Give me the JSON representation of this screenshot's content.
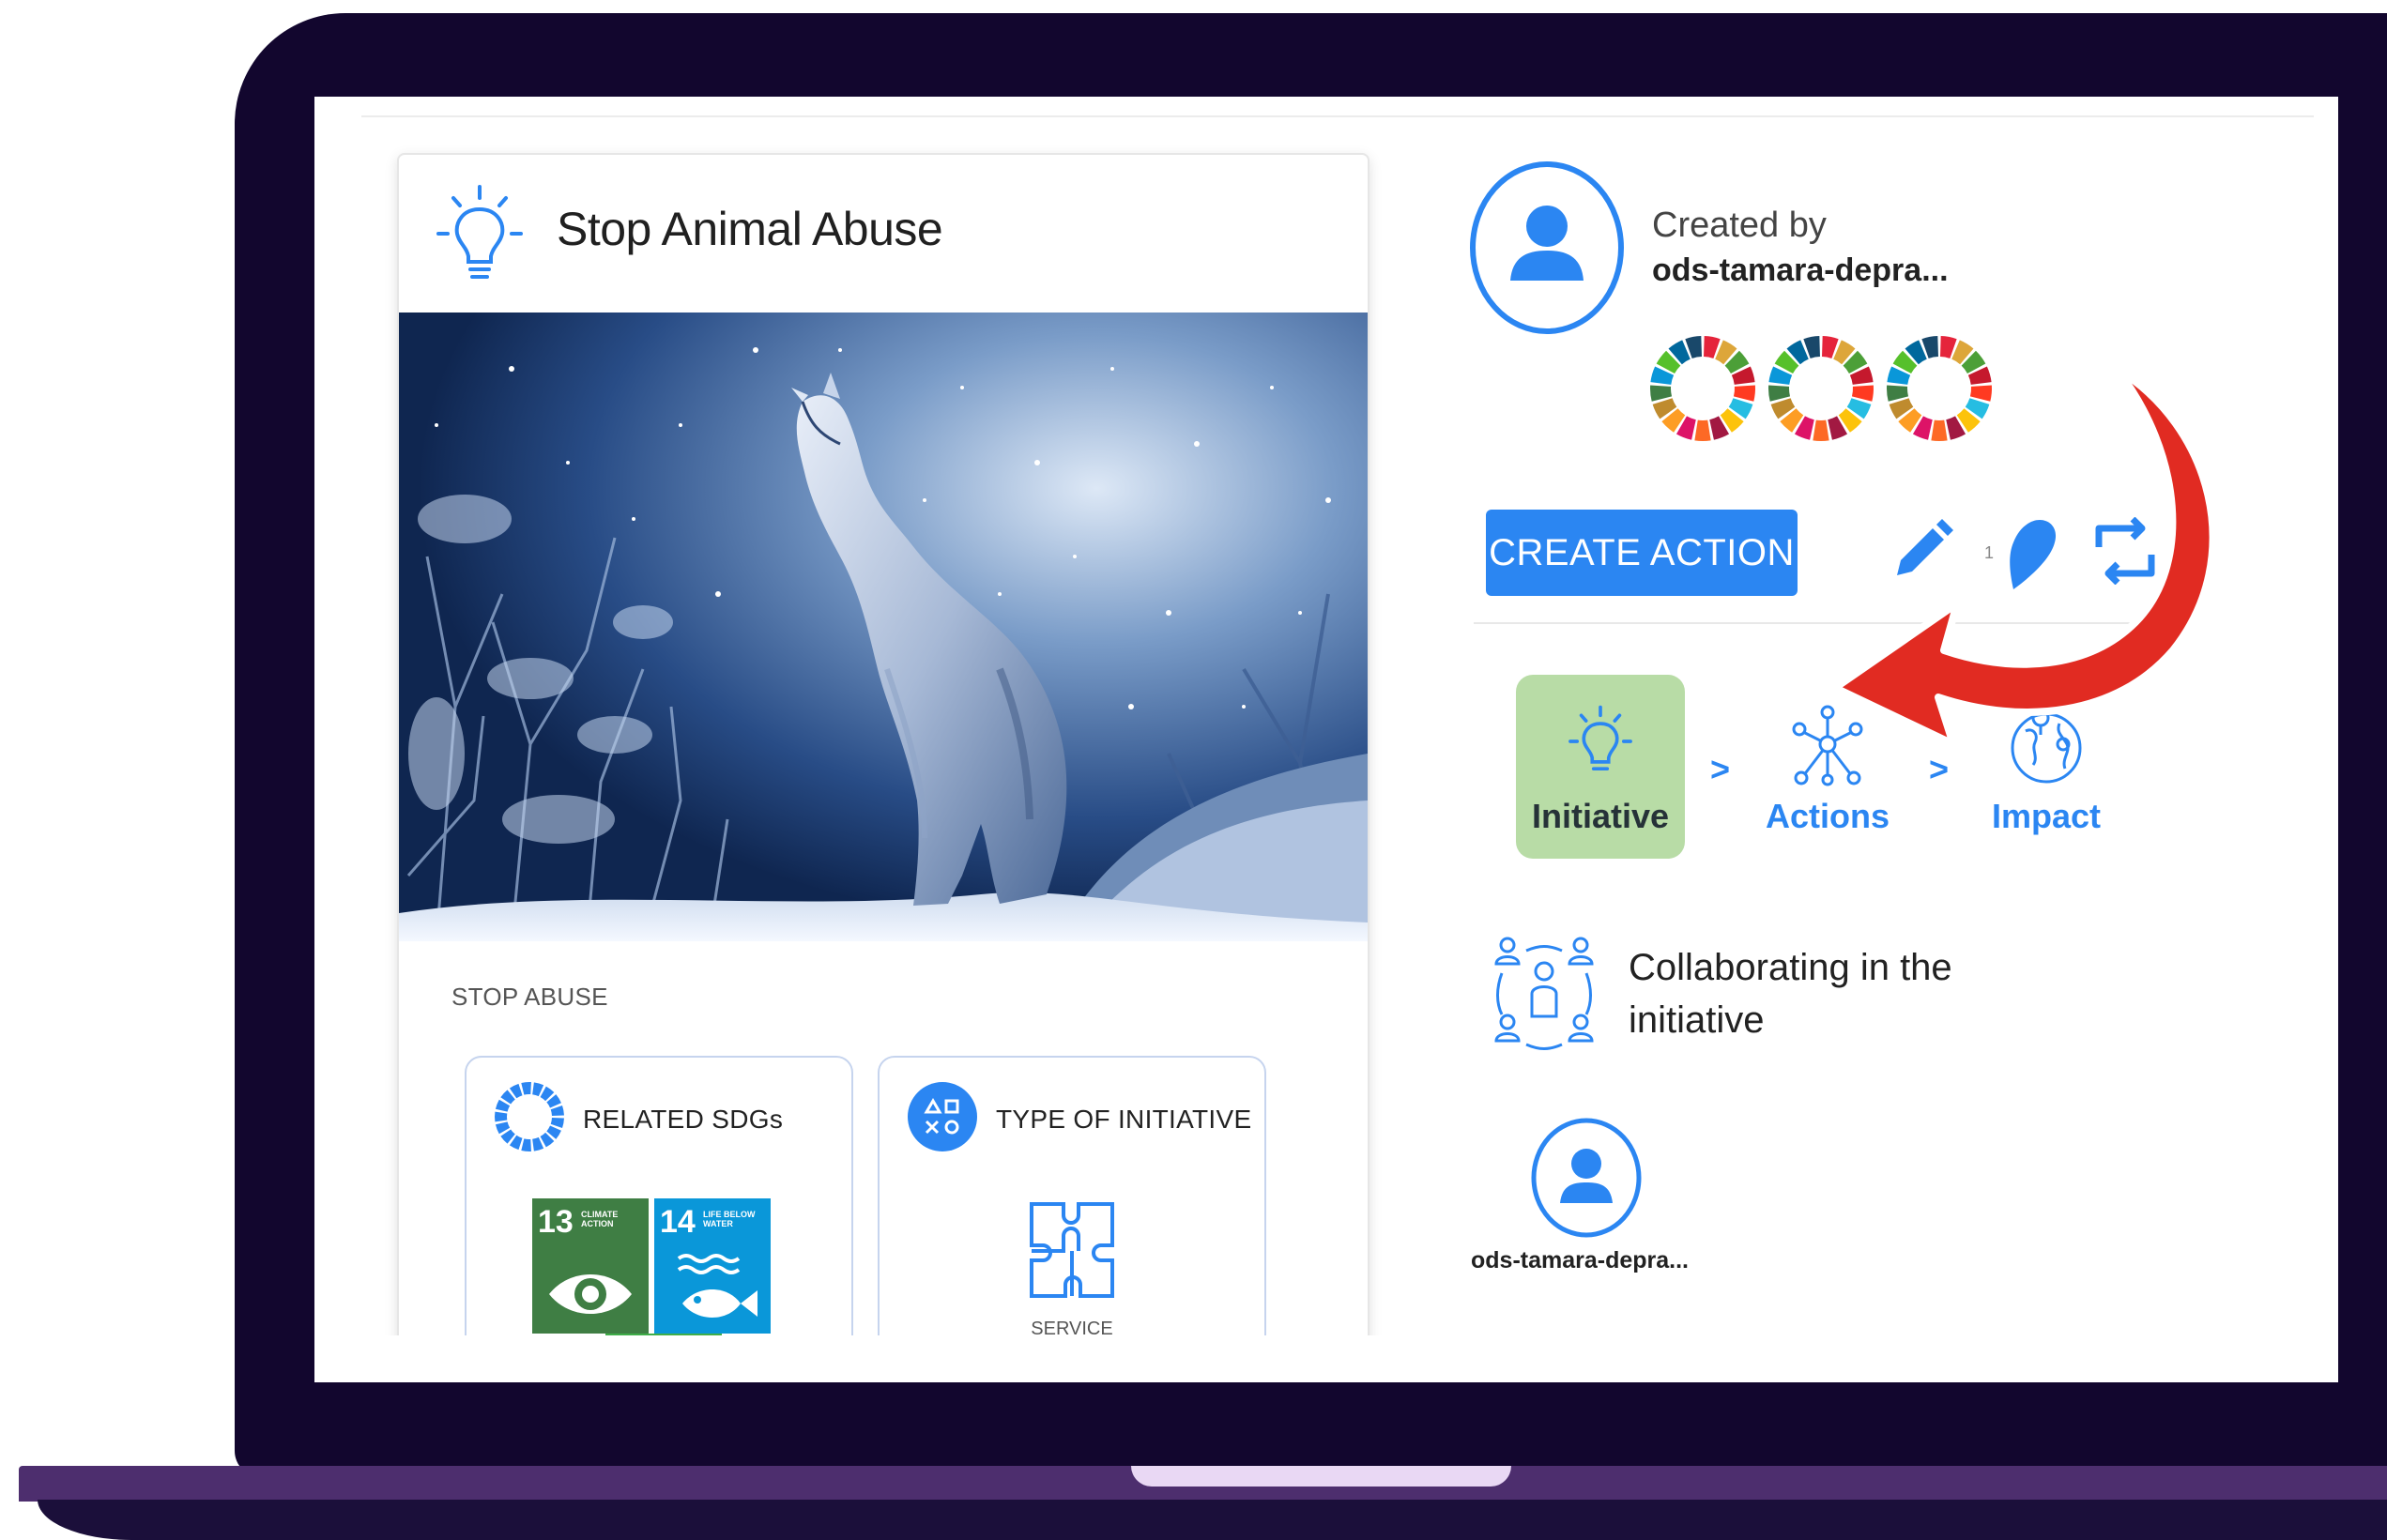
{
  "initiative": {
    "title": "Stop Animal Abuse",
    "subtitle": "STOP ABUSE",
    "related_sdgs_label": "RELATED SDGs",
    "type_label": "TYPE OF INITIATIVE",
    "type_value": "SERVICE",
    "sdg_tiles": [
      {
        "number": "13",
        "caption": "CLIMATE ACTION",
        "color": "#3f7e44"
      },
      {
        "number": "14",
        "caption": "LIFE BELOW WATER",
        "color": "#0a97d9"
      }
    ]
  },
  "creator": {
    "created_by_label": "Created by",
    "name": "ods-tamara-depra..."
  },
  "actions": {
    "create_action_label": "CREATE ACTION",
    "like_count": "1"
  },
  "steps": [
    {
      "label": "Initiative",
      "active": true
    },
    {
      "label": "Actions",
      "active": false
    },
    {
      "label": "Impact",
      "active": false
    }
  ],
  "step_separator": ">",
  "collaborators": {
    "heading": "Collaborating in the initiative",
    "members": [
      {
        "name": "ods-tamara-depra..."
      }
    ]
  },
  "colors": {
    "accent_blue": "#2b86f2",
    "active_step_bg": "#b8dca6",
    "arrow_red": "#e12b22",
    "laptop_frame": "#12062e"
  }
}
